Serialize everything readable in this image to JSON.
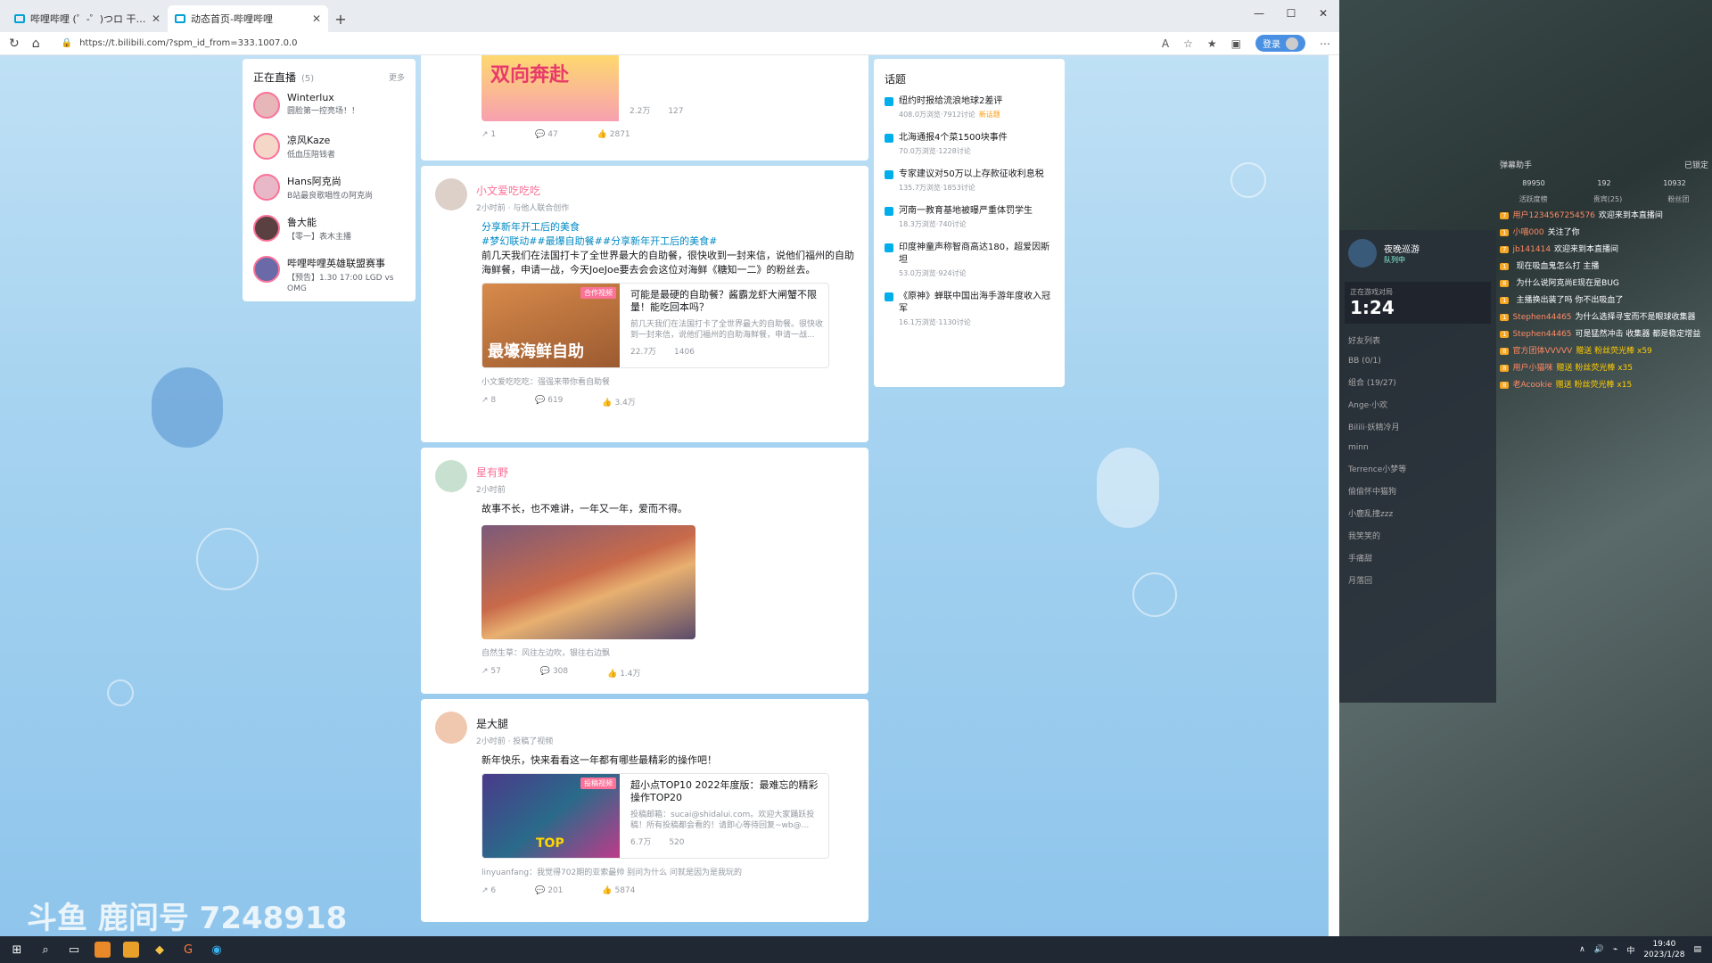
{
  "browser": {
    "tabs": [
      {
        "title": "哔哩哔哩 (゜-゜)つロ 干杯~-bilil",
        "active": false
      },
      {
        "title": "动态首页-哔哩哔哩",
        "active": true
      }
    ],
    "url": "https://t.bilibili.com/?spm_id_from=333.1007.0.0",
    "login_label": "登录"
  },
  "live": {
    "title": "正在直播",
    "count": "(5)",
    "more": "更多",
    "items": [
      {
        "name": "Winterlux",
        "sub": "圆脸第一控亮场！！"
      },
      {
        "name": "凉风Kaze",
        "sub": "低血压陪钱者"
      },
      {
        "name": "Hans阿克尚",
        "sub": "B站最良歌唱性の阿克尚"
      },
      {
        "name": "鲁大能",
        "sub": "【零一】表木主播"
      },
      {
        "name": "哔哩哔哩英雄联盟赛事",
        "sub": "【预告】1.30 17:00 LGD vs OMG"
      }
    ]
  },
  "posts": [
    {
      "actions": {
        "share": "1",
        "comment": "47",
        "like": "2871"
      },
      "archive": {
        "badge": "",
        "stats": [
          "2.2万",
          "127"
        ],
        "thumb_text": "双向奔赴"
      }
    },
    {
      "name": "小文爱吃吃吃",
      "meta": "2小时前 · 与他人联合创作",
      "tag": "分享新年开工后的美食",
      "topics": "#梦幻联动##最爆自助餐##分享新年开工后的美食#",
      "text": "前几天我们在法国打卡了全世界最大的自助餐，很快收到一封来信，说他们福州的自助海鲜餐，申请一战，今天JoeJoe要去会会这位对海鲜《糖知一二》的粉丝去。",
      "archive": {
        "badge": "合作视频",
        "title": "可能是最硬的自助餐？酱霸龙虾大闸蟹不限量！能吃回本吗？",
        "desc": "前几天我们在法国打卡了全世界最大的自助餐。很快收到一封来信，说他们福州的自助海鲜餐，申请一战...",
        "stats": [
          "22.7万",
          "1406"
        ],
        "thumb_text": "最壕海鲜自助"
      },
      "comment": "小文爱吃吃吃：强强来带你看自助餐",
      "actions": {
        "share": "8",
        "comment": "619",
        "like": "3.4万"
      }
    },
    {
      "name": "星有野",
      "meta": "2小时前",
      "text": "故事不长，也不难讲，一年又一年，爱而不得。",
      "comment": "自然生草：风往左边吹，银往右边飘",
      "actions": {
        "share": "57",
        "comment": "308",
        "like": "1.4万"
      }
    },
    {
      "name": "是大腿",
      "meta": "2小时前 · 投稿了视频",
      "text": "新年快乐，快来看看这一年都有哪些最精彩的操作吧！",
      "archive": {
        "badge": "投稿视频",
        "title": "超小点TOP10 2022年度版：最难忘的精彩操作TOP20",
        "desc": "投稿邮箱：sucai@shidalui.com。欢迎大家踊跃投稿！所有投稿都会看的！请即心等待回复~wb@...",
        "stats": [
          "6.7万",
          "520"
        ],
        "thumb_text": "TOP"
      },
      "comment": "linyuanfang：我觉得702期的亚索最帅 别问为什么 问就是因为是我玩的",
      "actions": {
        "share": "6",
        "comment": "201",
        "like": "5874"
      }
    }
  ],
  "topics": {
    "title": "话题",
    "items": [
      {
        "name": "纽约时报给流浪地球2差评",
        "stat": "408.0万浏览·7912讨论",
        "tag": "新话题"
      },
      {
        "name": "北海通报4个菜1500块事件",
        "stat": "70.0万浏览·1228讨论",
        "tag": ""
      },
      {
        "name": "专家建议对50万以上存款征收利息税",
        "stat": "135.7万浏览·1853讨论",
        "tag": ""
      },
      {
        "name": "河南一教育基地被曝严重体罚学生",
        "stat": "18.3万浏览·740讨论",
        "tag": ""
      },
      {
        "name": "印度神童声称智商高达180，超爱因斯坦",
        "stat": "53.0万浏览·924讨论",
        "tag": ""
      },
      {
        "name": "《原神》蝉联中国出海手游年度收入冠军",
        "stat": "16.1万浏览·1130讨论",
        "tag": ""
      }
    ]
  },
  "stream": {
    "chat_title": "弹幕助手",
    "chat_status": "已锁定",
    "stats": [
      "89950",
      "192",
      "10932"
    ],
    "tabs": [
      "活跃度榜",
      "贵宾(25)",
      "粉丝团"
    ],
    "messages": [
      {
        "lv": "7",
        "name": "用户1234567254576",
        "text": "欢迎来到本直播间"
      },
      {
        "lv": "1",
        "name": "小喵000",
        "text": "关注了你"
      },
      {
        "lv": "7",
        "name": "jb141414",
        "text": "欢迎来到本直播间"
      },
      {
        "lv": "1",
        "name": "",
        "text": "现在吸血鬼怎么打 主播"
      },
      {
        "lv": "8",
        "name": "",
        "text": "为什么说阿克尚E现在是BUG"
      },
      {
        "lv": "1",
        "name": "",
        "text": "主播换出装了吗 你不出吸血了"
      },
      {
        "lv": "1",
        "name": "Stephen44465",
        "text": "为什么选择寻宝而不是眼球收集器"
      },
      {
        "lv": "1",
        "name": "Stephen44465",
        "text": "可是猛然冲击 收集器 都是稳定增益"
      },
      {
        "lv": "8",
        "name": "官方团体VVVVV",
        "text": "赠送 粉丝荧光棒 x59"
      },
      {
        "lv": "8",
        "name": "用户小猫咪",
        "text": "赠送 粉丝荧光棒 x35"
      },
      {
        "lv": "8",
        "name": "老Acookie",
        "text": "赠送 粉丝荧光棒 x15"
      }
    ],
    "friend_panel": {
      "name": "夜晚巡游",
      "status": "队列中",
      "label": "正在游戏对局",
      "time": "1:24",
      "friends_label": "好友列表",
      "groups": [
        "BB (0/1)",
        "组合 (19/27)"
      ],
      "friends": [
        "Ange·小欢",
        "Bilili·妖精冷月",
        "minn",
        "Terrence小梦等",
        "偷偷怀中猫狗",
        "小鹿乱撞zzz",
        "我笑笑的",
        "手痛甜",
        "月落回"
      ]
    },
    "watermark": "斗鱼 鹿间号 7248918"
  },
  "taskbar": {
    "time": "19:40",
    "date": "2023/1/28",
    "ime": "中"
  }
}
